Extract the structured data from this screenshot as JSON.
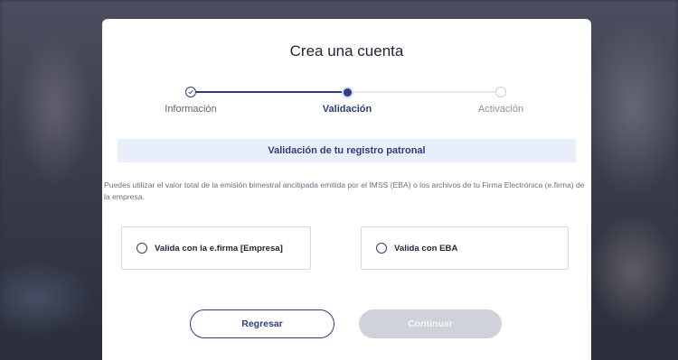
{
  "modal": {
    "title": "Crea una cuenta"
  },
  "stepper": {
    "steps": [
      {
        "label": "Información",
        "state": "completed"
      },
      {
        "label": "Validación",
        "state": "active"
      },
      {
        "label": "Activación",
        "state": "pending"
      }
    ]
  },
  "section": {
    "heading": "Validación de tu registro patronal",
    "description": "Puedes utilizar el valor total de la emisión bimestral ancitipada emitida por el IMSS (EBA) o los archivos de tu Firma Electrónica (e.firma) de la empresa."
  },
  "options": [
    {
      "label": "Valida con la e.firma [Empresa]",
      "selected": false
    },
    {
      "label": "Valida con EBA",
      "selected": false
    }
  ],
  "buttons": {
    "back_label": "Regresar",
    "continue_label": "Continuar",
    "continue_enabled": false
  },
  "colors": {
    "primary": "#2e3d7e",
    "section_bg": "#e9eefb",
    "disabled_button": "#cfd2d8"
  }
}
